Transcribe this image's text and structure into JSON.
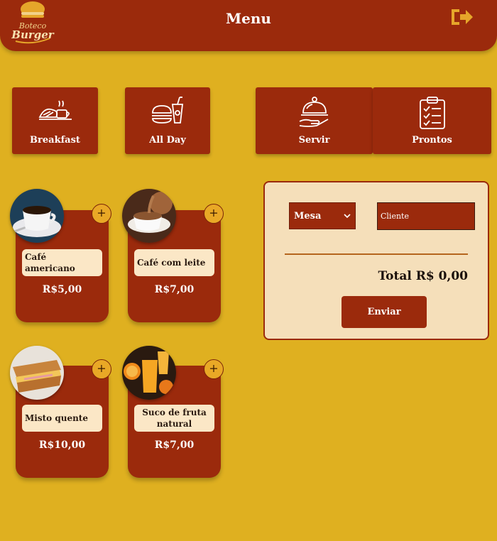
{
  "header": {
    "title": "Menu",
    "logo_text_1": "Boteco",
    "logo_text_2": "Burger",
    "logout_icon": "sign-out-icon"
  },
  "categories": [
    {
      "label": "Breakfast",
      "icon": "breakfast-icon"
    },
    {
      "label": "All Day",
      "icon": "burger-meal-icon"
    },
    {
      "label": "Servir",
      "icon": "serving-cloche-icon"
    },
    {
      "label": "Prontos",
      "icon": "clipboard-checklist-icon"
    }
  ],
  "products": [
    {
      "name": "Café americano",
      "price": "R$5,00"
    },
    {
      "name": "Café com leite",
      "price": "R$7,00"
    },
    {
      "name": "Misto quente",
      "price": "R$10,00"
    },
    {
      "name": "Suco de fruta natural",
      "price": "R$7,00"
    }
  ],
  "add_label": "+",
  "order": {
    "table_select": "Mesa",
    "client_placeholder": "Cliente",
    "total": "Total R$ 0,00",
    "send_label": "Enviar"
  },
  "colors": {
    "background": "#dfb020",
    "primary": "#9b2a0c",
    "panel": "#f5dfba",
    "card_label": "#fbe7c6"
  }
}
